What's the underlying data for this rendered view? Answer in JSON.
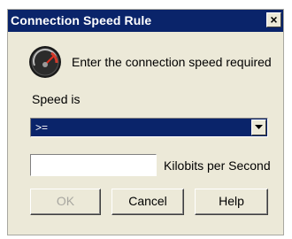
{
  "window": {
    "title": "Connection Speed Rule",
    "close_glyph": "×"
  },
  "icon": "speedometer-icon",
  "prompt": "Enter the connection speed required",
  "speed": {
    "label": "Speed is",
    "selected": ">="
  },
  "rate": {
    "value": "",
    "unit_label": "Kilobits per Second"
  },
  "buttons": {
    "ok": "OK",
    "cancel": "Cancel",
    "help": "Help"
  },
  "colors": {
    "titlebar": "#0a246a",
    "dialog_face": "#ece9d8",
    "disabled_text": "#a8a7a0"
  }
}
